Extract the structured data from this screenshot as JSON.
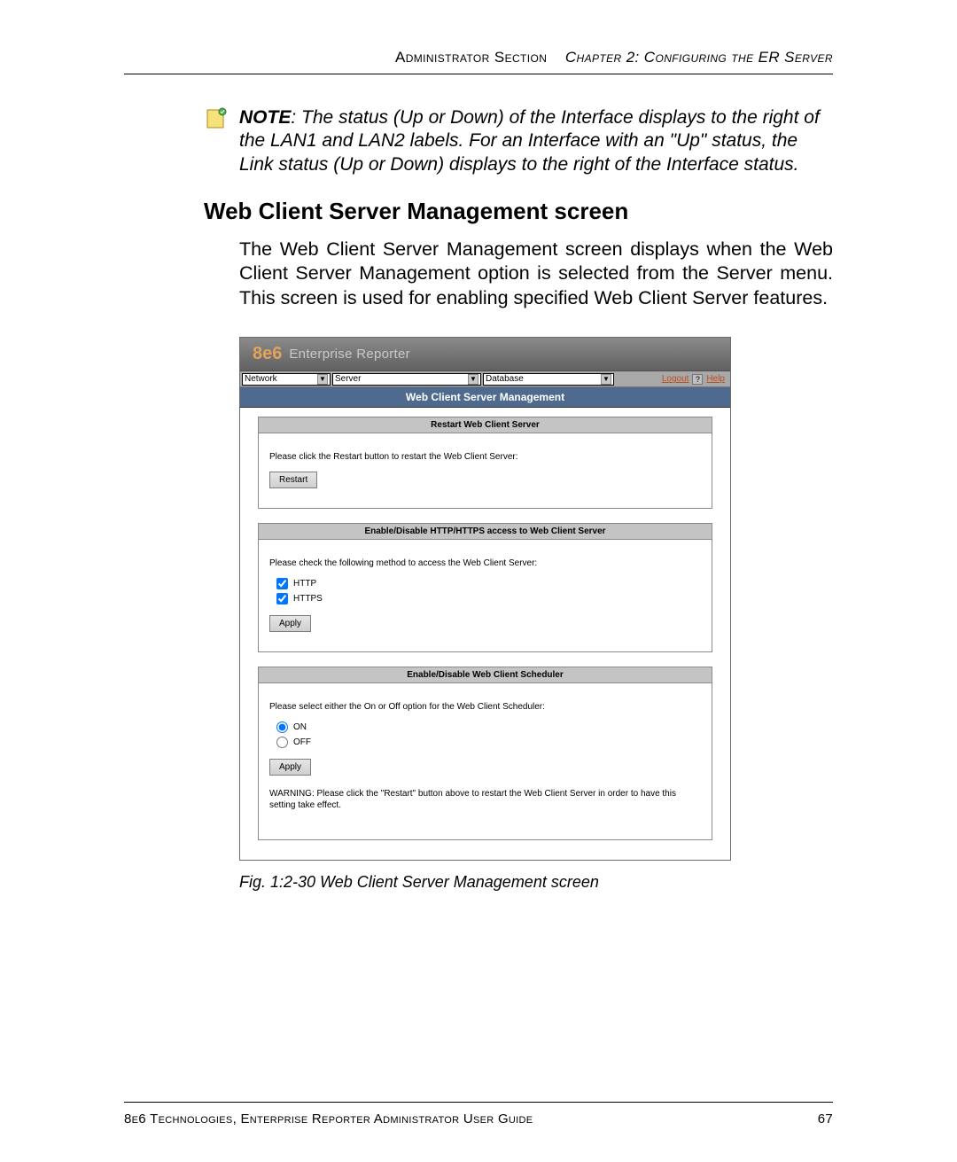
{
  "header": {
    "left": "Administrator Section",
    "right_italic": "Chapter 2: Configuring the ER Server"
  },
  "note": {
    "label": "NOTE",
    "text": ": The status (Up or Down) of the Interface displays to the right of the LAN1 and LAN2 labels. For an Interface with an \"Up\" status, the Link status (Up or Down) displays to the right of the Interface status."
  },
  "section_heading": "Web Client Server Management screen",
  "body_para": "The Web Client Server Management screen displays when the Web Client Server Management option is selected from the Server menu. This screen is used for enabling specified Web Client Server features.",
  "app": {
    "logo": "8e6",
    "product": "Enterprise Reporter",
    "menus": {
      "network": "Network",
      "server": "Server",
      "database": "Database"
    },
    "links": {
      "logout": "Logout",
      "help": "Help"
    },
    "screen_title": "Web Client Server Management",
    "panel1": {
      "title": "Restart Web Client Server",
      "text": "Please click the Restart button to restart the Web Client Server:",
      "button": "Restart"
    },
    "panel2": {
      "title": "Enable/Disable HTTP/HTTPS access to Web Client Server",
      "text": "Please check the following method to access the Web Client Server:",
      "opt_http": "HTTP",
      "opt_https": "HTTPS",
      "button": "Apply"
    },
    "panel3": {
      "title": "Enable/Disable Web Client Scheduler",
      "text": "Please select either the On or Off option for the Web Client Scheduler:",
      "opt_on": "ON",
      "opt_off": "OFF",
      "button": "Apply",
      "warning": "WARNING: Please click the \"Restart\" button above to restart the Web Client Server in order to have this setting take effect."
    }
  },
  "fig_caption": "Fig. 1:2-30  Web Client Server Management screen",
  "footer": {
    "left": "8e6 Technologies, Enterprise Reporter Administrator User Guide",
    "right": "67"
  }
}
